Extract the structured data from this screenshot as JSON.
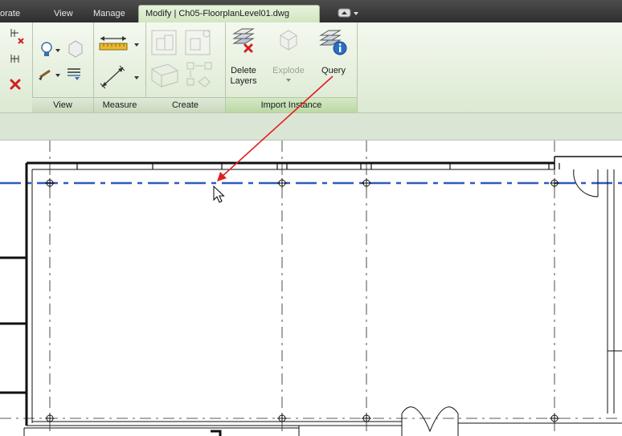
{
  "tabs": {
    "collaborate_partial": "orate",
    "view": "View",
    "manage": "Manage",
    "contextual": "Modify | Ch05-FloorplanLevel01.dwg"
  },
  "ribbon": {
    "panels": {
      "view": "View",
      "measure": "Measure",
      "create": "Create",
      "import_instance": "Import Instance"
    },
    "buttons": {
      "delete_layers_line1": "Delete",
      "delete_layers_line2": "Layers",
      "explode": "Explode",
      "query": "Query"
    }
  },
  "colors": {
    "tab_bar": "#3d3d3d",
    "active_tab": "#d9ebcb",
    "ribbon_bg": "#e8f1e0",
    "options_bar": "#dbe5d6",
    "grid_line": "#2f5bbf",
    "callout_arrow": "#e02020"
  },
  "icons": [
    "modify-icon",
    "lightbulb-icon",
    "paintbrush-icon",
    "measure-ruler-icon",
    "dimension-icon",
    "group-icon",
    "component-icon",
    "delete-layers-icon",
    "explode-icon",
    "query-icon",
    "cursor-arrow-icon"
  ]
}
